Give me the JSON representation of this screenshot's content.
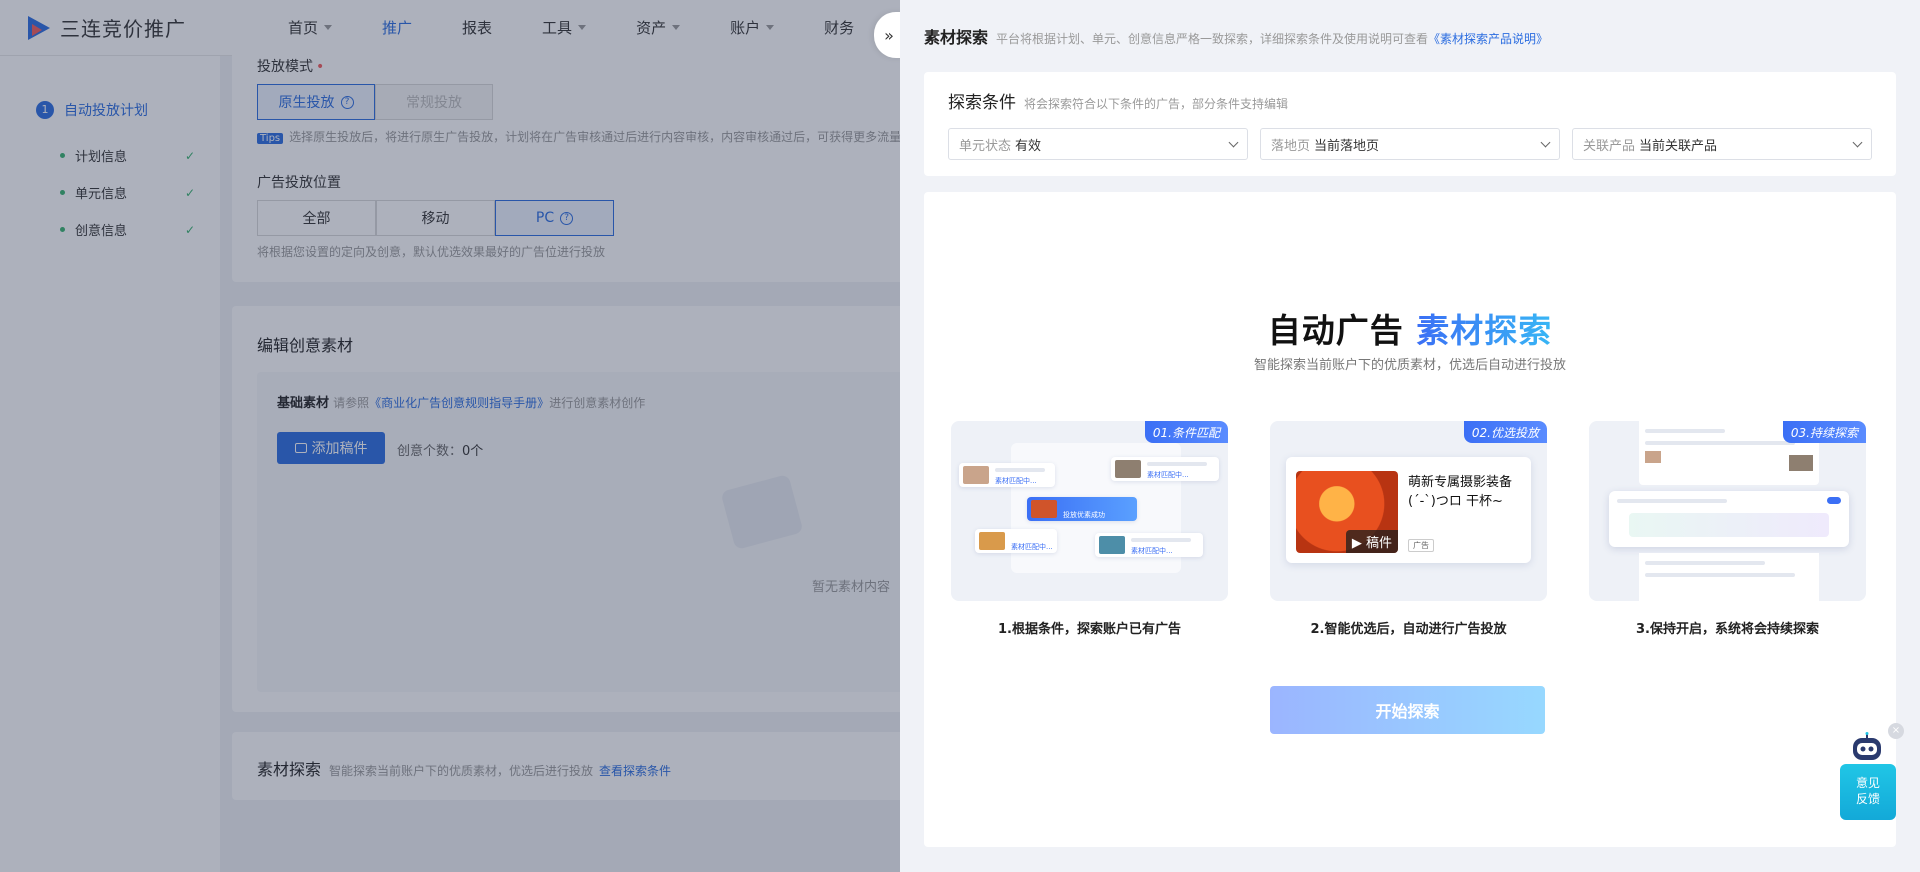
{
  "app": {
    "logo_text": "三连竞价推广",
    "nav": [
      {
        "label": "首页",
        "caret": true
      },
      {
        "label": "推广",
        "caret": false,
        "active": true
      },
      {
        "label": "报表",
        "caret": false
      },
      {
        "label": "工具",
        "caret": true
      },
      {
        "label": "资产",
        "caret": true
      },
      {
        "label": "账户",
        "caret": true
      },
      {
        "label": "财务",
        "caret": false
      }
    ]
  },
  "sidebar": {
    "step_num": "1",
    "step_label": "自动投放计划",
    "sub_items": [
      "计划信息",
      "单元信息",
      "创意信息"
    ],
    "check_mark": "✓"
  },
  "form": {
    "mode_label": "投放模式",
    "required_mark": "•",
    "mode_options": [
      "原生投放",
      "常规投放"
    ],
    "tips_tag": "Tips",
    "tips_text": "选择原生投放后，将进行原生广告投放，计划将在广告审核通过后进行内容审核，内容审核通过后，可获得更多流量",
    "position_label": "广告投放位置",
    "position_options": [
      "全部",
      "移动",
      "PC"
    ],
    "position_hint": "将根据您设置的定向及创意，默认优选效果最好的广告位进行投放",
    "creative_title": "编辑创意素材",
    "basic_label": "基础素材",
    "basic_hint_pre": "请参照",
    "basic_hint_link": "《商业化广告创意规则指导手册》",
    "basic_hint_post": "进行创意素材创作",
    "add_button": "添加稿件",
    "count_label": "创意个数：",
    "count_value": "0个",
    "empty_text": "暂无素材内容",
    "explore_title": "素材探索",
    "explore_desc": "智能探索当前账户下的优质素材，优选后进行投放",
    "explore_link": "查看探索条件"
  },
  "drawer": {
    "collapse_icon": "»",
    "title": "素材探索",
    "desc": "平台将根据计划、单元、创意信息严格一致探索，详细探索条件及使用说明可查看",
    "link": "《素材探索产品说明》",
    "conditions": {
      "title": "探索条件",
      "desc": "将会探索符合以下条件的广告，部分条件支持编辑",
      "selects": [
        {
          "key": "单元状态",
          "value": "有效"
        },
        {
          "key": "落地页",
          "value": "当前落地页"
        },
        {
          "key": "关联产品",
          "value": "当前关联产品"
        }
      ]
    },
    "hero": {
      "title_black": "自动广告",
      "title_accent": "素材探索",
      "subtitle": "智能探索当前账户下的优质素材，优选后自动进行投放"
    },
    "features": [
      {
        "badge": "01.条件匹配",
        "caption": "1.根据条件，探索账户已有广告"
      },
      {
        "badge": "02.优选投放",
        "caption": "2.智能优选后，自动进行广告投放"
      },
      {
        "badge": "03.持续探索",
        "caption": "3.保持开启，系统将会持续探索"
      }
    ],
    "illustration": {
      "mini_tag": "素材匹配中...",
      "mini_tag_active": "投放优素成功",
      "ad_text": "萌新专属摄影装备 (´-`)つロ 干杯~",
      "ad_play": "▶ 稿件",
      "ad_tag": "广告"
    },
    "start_button": "开始探索"
  },
  "feedback": {
    "label_line1": "意见",
    "label_line2": "反馈",
    "close": "×"
  },
  "colors": {
    "primary": "#2b6de0",
    "success": "#37b36f",
    "accent_gradient_start": "#3b6ff5",
    "accent_gradient_end": "#38b6f5"
  }
}
